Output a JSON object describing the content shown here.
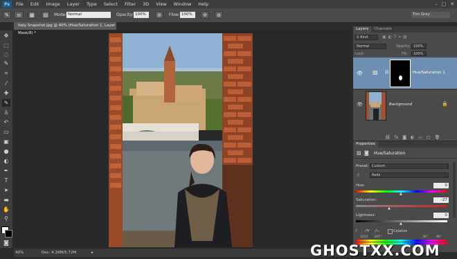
{
  "menu": [
    "File",
    "Edit",
    "Image",
    "Layer",
    "Type",
    "Select",
    "Filter",
    "3D",
    "View",
    "Window",
    "Help"
  ],
  "app_badge": "Ps",
  "options": {
    "mode_label": "Mode:",
    "mode_value": "Normal",
    "opacity_label": "Opacity:",
    "opacity_value": "100%",
    "flow_label": "Flow:",
    "flow_value": "100%",
    "brush_size": "30",
    "workspace": "Tim Grey"
  },
  "document": {
    "tab_title": "Italy Snapshot.jpg @ 40% (Hue/Saturation 1, Layer Mask/8) *",
    "zoom": "40%",
    "doc_size": "Doc: 4.29M/5.72M"
  },
  "layers_panel": {
    "tabs": [
      "Layers",
      "Channels"
    ],
    "kind_label": "Kind",
    "blend_mode": "Normal",
    "opacity_label": "Opacity:",
    "opacity_value": "100%",
    "lock_label": "Lock:",
    "fill_label": "Fill:",
    "fill_value": "100%",
    "layers": [
      {
        "name": "Hue/Saturation 1",
        "selected": true
      },
      {
        "name": "Background",
        "selected": false
      }
    ],
    "footer_icons": [
      "link-icon",
      "fx-icon",
      "mask-icon",
      "adjustment-icon",
      "folder-icon",
      "new-layer-icon",
      "trash-icon"
    ]
  },
  "properties_panel": {
    "tab": "Properties",
    "title": "Hue/Saturation",
    "preset_label": "Preset:",
    "preset_value": "Custom",
    "channel_value": "Reds",
    "hue_label": "Hue:",
    "hue_value": "0",
    "saturation_label": "Saturation:",
    "saturation_value": "-27",
    "lightness_label": "Lightness:",
    "lightness_value": "0",
    "colorize_label": "Colorize",
    "range_values": [
      "3225",
      "345°",
      "36°",
      "96°"
    ]
  },
  "watermark": "GHOSTXX.COM",
  "colors": {
    "selected_layer": "#6e8fb3",
    "panel_bg": "#4a4a4a",
    "canvas_bg": "#282828"
  }
}
